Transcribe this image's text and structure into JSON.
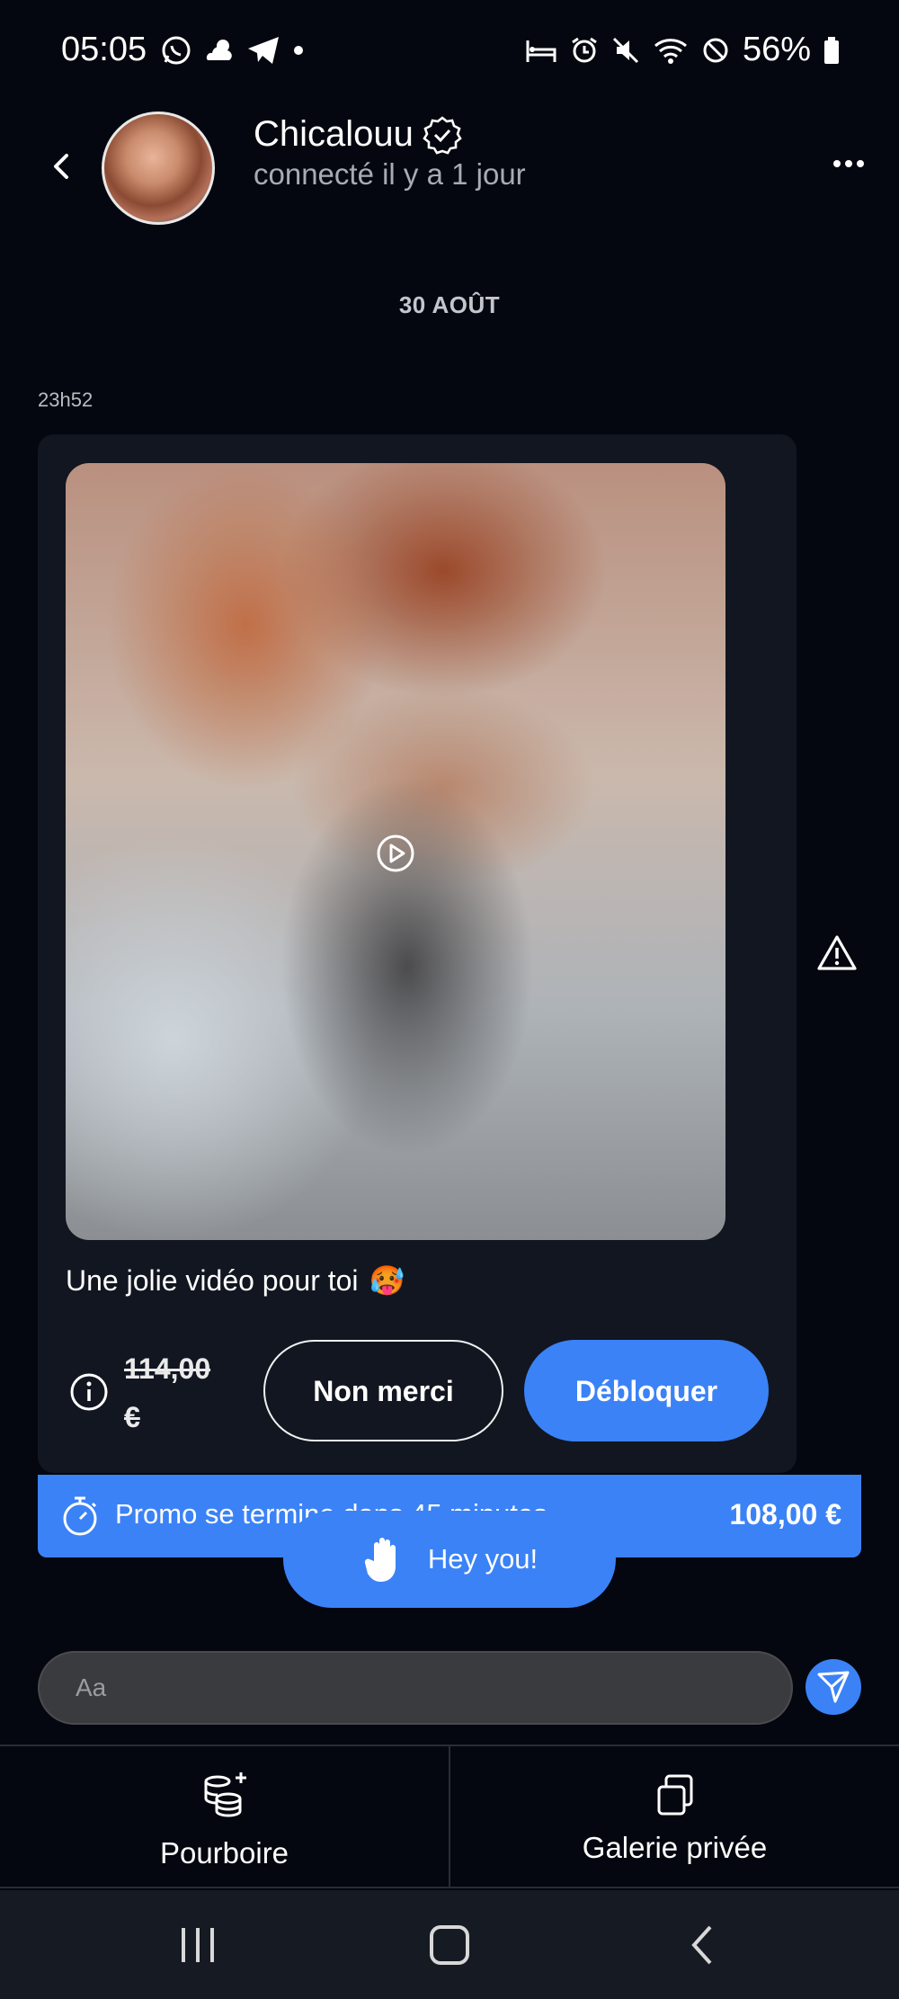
{
  "status_bar": {
    "time": "05:05",
    "battery": "56%"
  },
  "header": {
    "name": "Chicalouu",
    "presence": "connecté il y a 1 jour"
  },
  "conversation": {
    "date_separator": "30 AOÛT",
    "message_time": "23h52",
    "message": {
      "caption": "Une jolie vidéo pour toi",
      "caption_emoji": "🥵",
      "old_price": "114,00 €",
      "decline_label": "Non merci",
      "unlock_label": "Débloquer"
    }
  },
  "promo": {
    "text": "Promo se termine dans 45 minutes",
    "price": "108,00 €"
  },
  "hey_button": {
    "label": "Hey you!"
  },
  "composer": {
    "placeholder": "Aa"
  },
  "tabs": [
    {
      "label": "Pourboire",
      "icon": "coins-plus-icon"
    },
    {
      "label": "Galerie privée",
      "icon": "copy-icon"
    }
  ],
  "colors": {
    "accent": "#3b82f6",
    "background": "#04070f",
    "card": "#111620"
  }
}
